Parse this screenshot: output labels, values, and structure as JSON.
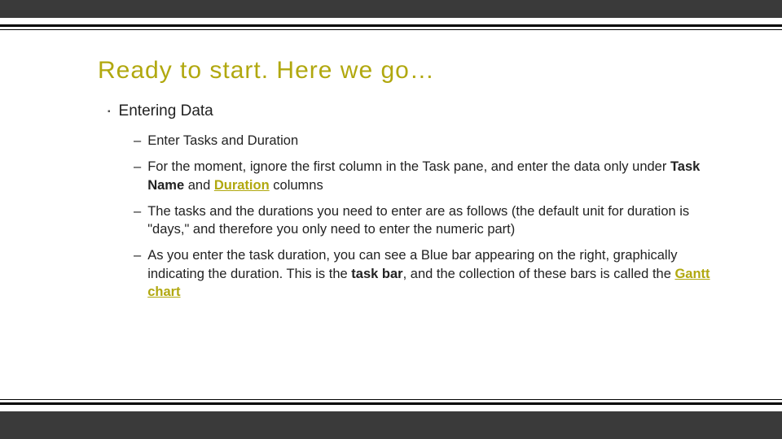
{
  "title": "Ready to start. Here we go…",
  "section": {
    "heading": "Entering Data"
  },
  "items": [
    {
      "text": "Enter Tasks and Duration"
    },
    {
      "pre": "For the moment, ignore the first column in the Task pane, and enter the data only under ",
      "b1": "Task Name",
      "mid": " and ",
      "link1": "Duration",
      "post": " columns"
    },
    {
      "text": "The tasks and the durations you need to enter are as follows (the default unit for duration is \"days,\" and therefore you only need to enter the numeric part)"
    },
    {
      "pre": "As you enter the task duration, you can see a Blue bar appearing on the right, graphically indicating the duration. This is the ",
      "b1": "task bar",
      "mid": ", and the collection of these bars is called the ",
      "link1": "Gantt chart",
      "post": ""
    }
  ]
}
